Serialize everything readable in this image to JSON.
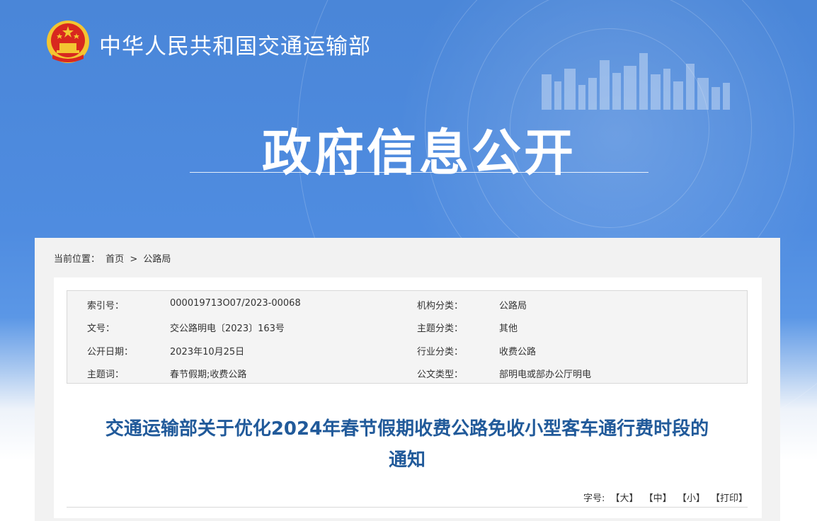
{
  "header": {
    "site_name": "中华人民共和国交通运输部",
    "section_title": "政府信息公开"
  },
  "breadcrumb": {
    "label": "当前位置：",
    "items": [
      "首页",
      "公路局"
    ],
    "separator": ">"
  },
  "meta": {
    "rows": [
      {
        "k1": "索引号：",
        "v1": "000019713O07/2023-00068",
        "k2": "机构分类：",
        "v2": "公路局"
      },
      {
        "k1": "文号：",
        "v1": "交公路明电〔2023〕163号",
        "k2": "主题分类：",
        "v2": "其他"
      },
      {
        "k1": "公开日期：",
        "v1": "2023年10月25日",
        "k2": "行业分类：",
        "v2": "收费公路"
      },
      {
        "k1": "主题词：",
        "v1": "春节假期;收费公路",
        "k2": "公文类型：",
        "v2": "部明电或部办公厅明电"
      }
    ]
  },
  "document": {
    "title_line1": "交通运输部关于优化2024年春节假期收费公路免收小型客车通行费时段的",
    "title_line2": "通知"
  },
  "font_tools": {
    "label": "字号:",
    "large": "【大】",
    "medium": "【中】",
    "small": "【小】",
    "print": "【打印】"
  },
  "colors": {
    "banner_blue": "#4a86d8",
    "title_blue": "#215a9a",
    "emblem_red": "#d8281f",
    "emblem_gold": "#f3c531"
  }
}
